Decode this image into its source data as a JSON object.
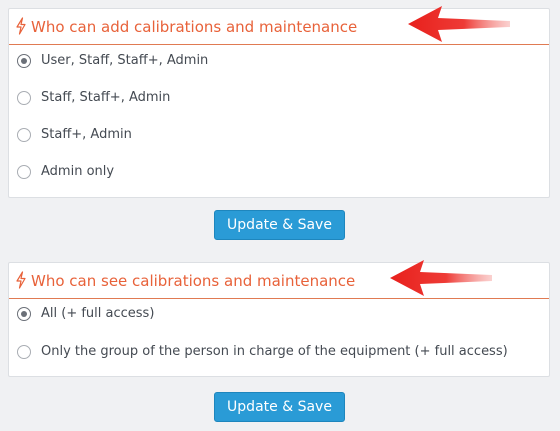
{
  "section_add": {
    "title": "Who can add calibrations and maintenance",
    "icon": "lightning-icon",
    "options": [
      {
        "label": "User, Staff, Staff+, Admin",
        "checked": true
      },
      {
        "label": "Staff, Staff+, Admin",
        "checked": false
      },
      {
        "label": "Staff+, Admin",
        "checked": false
      },
      {
        "label": "Admin only",
        "checked": false
      }
    ],
    "save_label": "Update & Save"
  },
  "section_see": {
    "title": "Who can see calibrations and maintenance",
    "icon": "lightning-icon",
    "options": [
      {
        "label": "All (+ full access)",
        "checked": true
      },
      {
        "label": "Only the group of the person in charge of the equipment (+ full access)",
        "checked": false
      }
    ],
    "save_label": "Update & Save"
  },
  "colors": {
    "accent_orange": "#e8623a",
    "button_blue": "#2a9bd6",
    "annotation_arrow": "#e8201c",
    "background": "#f0f1f3"
  }
}
